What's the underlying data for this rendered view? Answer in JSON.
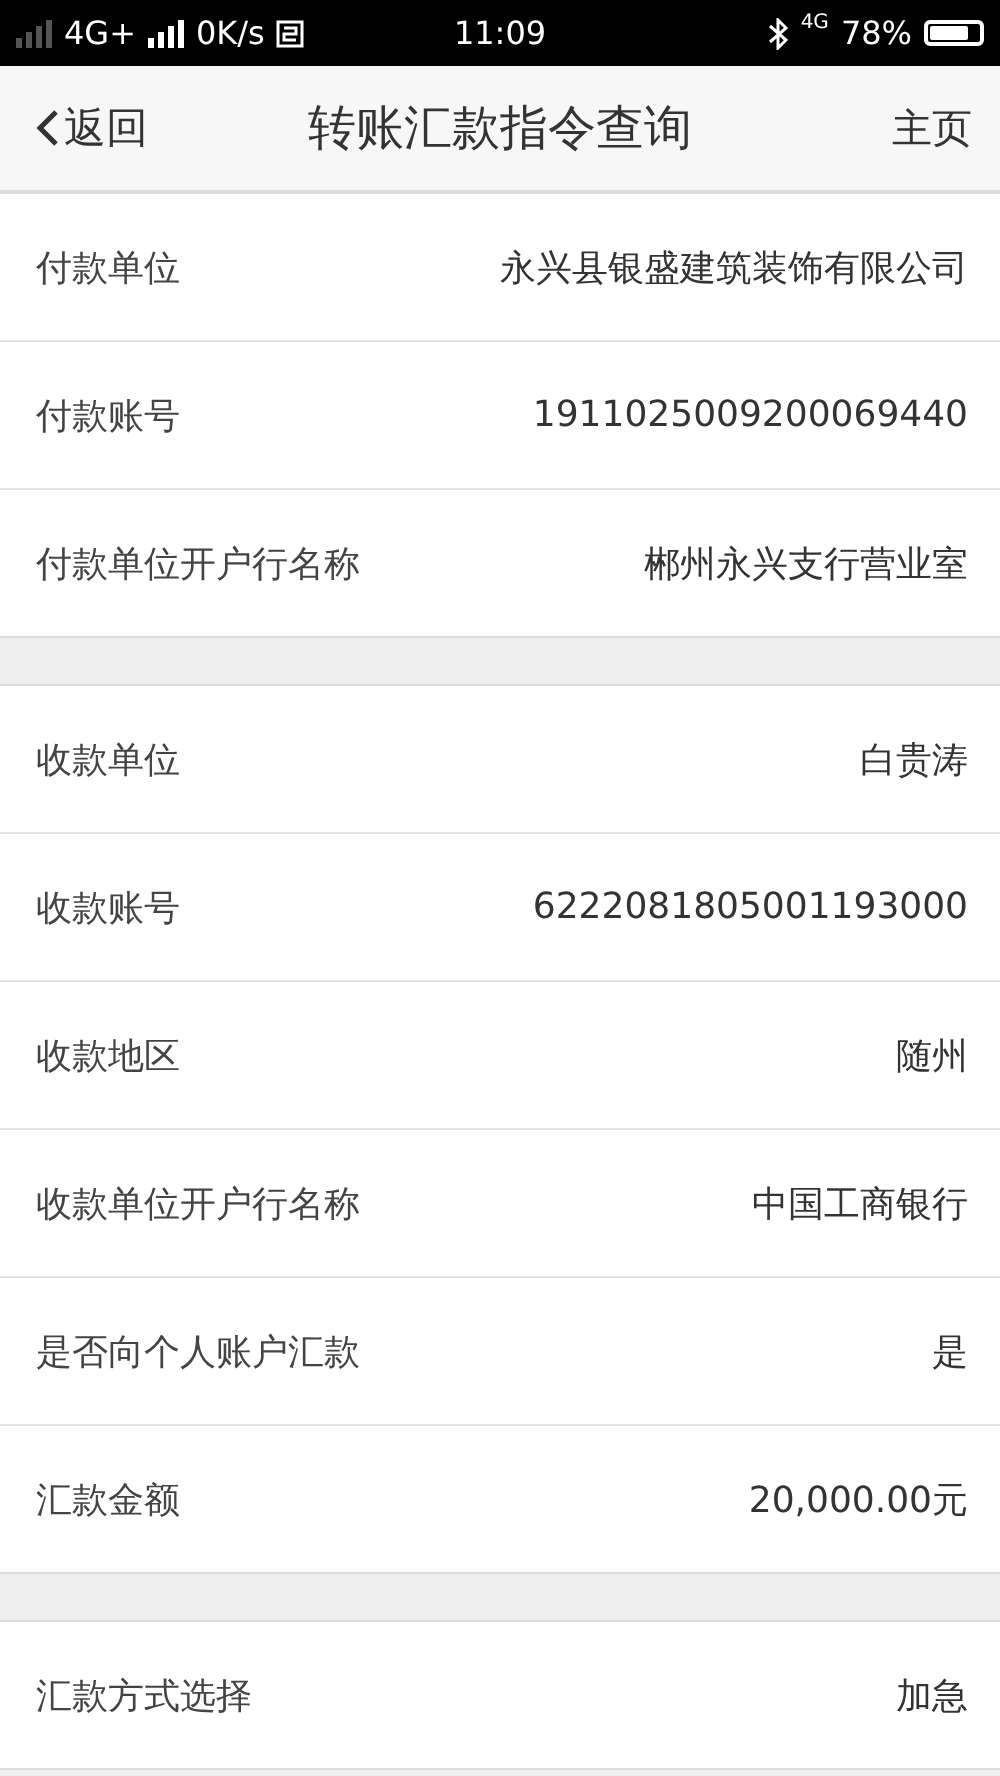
{
  "status_bar": {
    "network": "4G+",
    "speed": "0K/s",
    "time": "11:09",
    "network_2": "4G",
    "battery": "78%"
  },
  "nav": {
    "back": "返回",
    "title": "转账汇款指令查询",
    "home": "主页"
  },
  "groups": [
    [
      {
        "label": "付款单位",
        "value": "永兴县银盛建筑装饰有限公司"
      },
      {
        "label": "付款账号",
        "value": "1911025009200069440"
      },
      {
        "label": "付款单位开户行名称",
        "value": "郴州永兴支行营业室"
      }
    ],
    [
      {
        "label": "收款单位",
        "value": "白贵涛"
      },
      {
        "label": "收款账号",
        "value": "6222081805001193000"
      },
      {
        "label": "收款地区",
        "value": "随州"
      },
      {
        "label": "收款单位开户行名称",
        "value": "中国工商银行"
      },
      {
        "label": "是否向个人账户汇款",
        "value": "是"
      },
      {
        "label": "汇款金额",
        "value": "20,000.00元"
      }
    ],
    [
      {
        "label": "汇款方式选择",
        "value": "加急"
      }
    ]
  ]
}
